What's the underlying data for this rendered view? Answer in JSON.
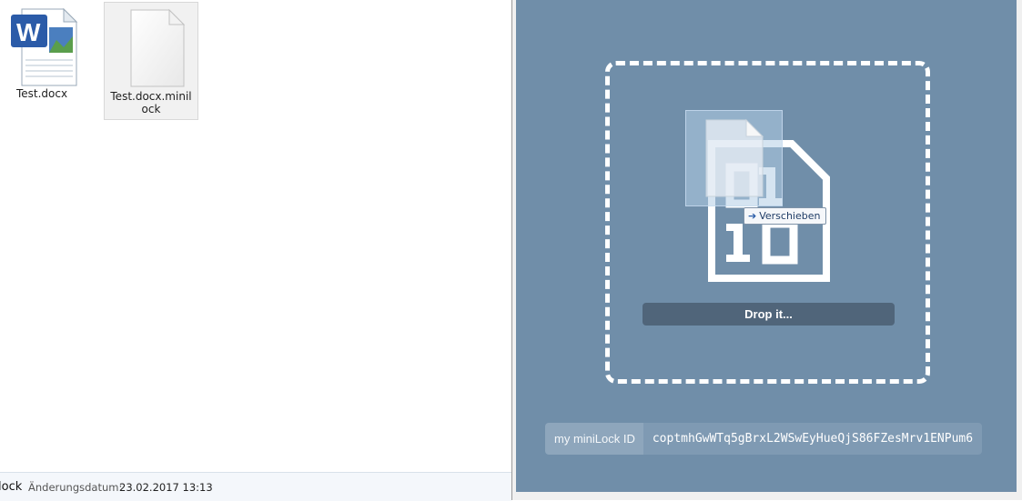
{
  "explorer": {
    "files": [
      {
        "name": "Test.docx",
        "icon": "word-document-icon"
      },
      {
        "name": "Test.docx.minilock",
        "icon": "blank-file-icon"
      }
    ],
    "details": {
      "name": "lock",
      "modified_label": "Änderungsdatum:",
      "modified_value": "23.02.2017 13:13"
    }
  },
  "minilock": {
    "drop_text": "Drop it...",
    "drag_tooltip": "Verschieben",
    "id_label": "my miniLock ID",
    "id_value": "coptmhGwWTq5gBrxL2WSwEyHueQjS86FZesMrv1ENPum6",
    "colors": {
      "background": "#708ea9",
      "drop_bar": "#50657a",
      "id_label_bg": "#8ea6bc"
    }
  }
}
